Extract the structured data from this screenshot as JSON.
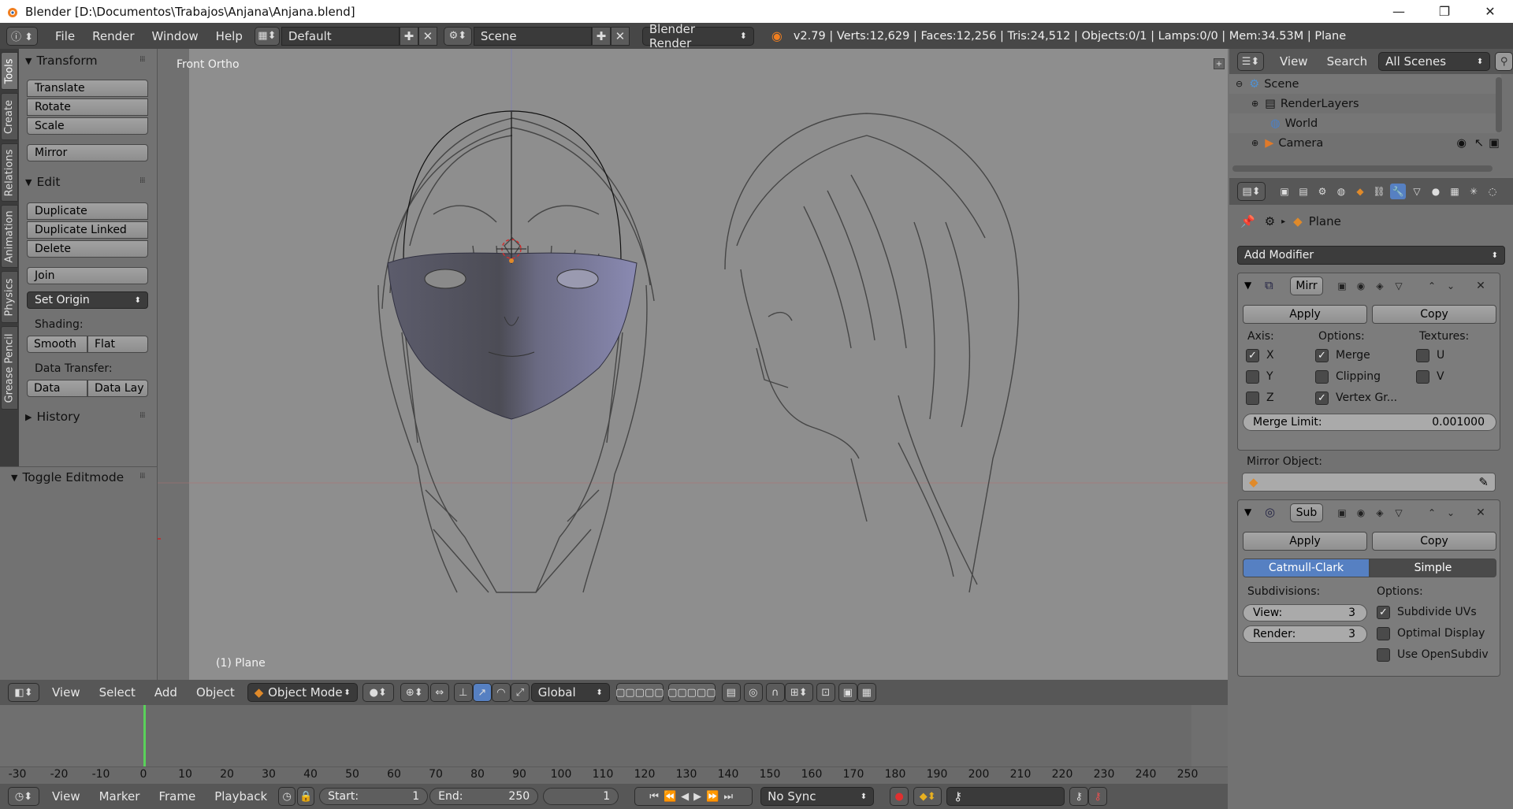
{
  "window": {
    "title": "Blender [D:\\Documentos\\Trabajos\\Anjana\\Anjana.blend]",
    "controls": [
      "—",
      "❐",
      "✕"
    ]
  },
  "infobar": {
    "menus": [
      "File",
      "Render",
      "Window",
      "Help"
    ],
    "screen_layout": "Default",
    "scene": "Scene",
    "render_engine": "Blender Render",
    "stats": "v2.79 | Verts:12,629 | Faces:12,256 | Tris:24,512 | Objects:0/1 | Lamps:0/0 | Mem:34.53M | Plane"
  },
  "left_tabs": [
    "Tools",
    "Create",
    "Relations",
    "Animation",
    "Physics",
    "Grease Pencil"
  ],
  "toolshelf": {
    "transform": {
      "title": "Transform",
      "buttons": [
        "Translate",
        "Rotate",
        "Scale",
        "Mirror"
      ]
    },
    "edit": {
      "title": "Edit",
      "buttons": [
        "Duplicate",
        "Duplicate Linked",
        "Delete",
        "Join"
      ],
      "set_origin": "Set Origin",
      "shading_label": "Shading:",
      "shading": [
        "Smooth",
        "Flat"
      ],
      "data_transfer_label": "Data Transfer:",
      "data_transfer": [
        "Data",
        "Data Lay"
      ]
    },
    "history": "History",
    "toggle_editmode": "Toggle Editmode"
  },
  "viewport": {
    "view_label": "Front Ortho",
    "object_label": "(1) Plane",
    "header_menus": [
      "View",
      "Select",
      "Add",
      "Object"
    ],
    "mode": "Object Mode",
    "orientation": "Global"
  },
  "timeline": {
    "ticks": [
      "-30",
      "-20",
      "-10",
      "0",
      "10",
      "20",
      "30",
      "40",
      "50",
      "60",
      "70",
      "80",
      "90",
      "100",
      "110",
      "120",
      "130",
      "140",
      "150",
      "160",
      "170",
      "180",
      "190",
      "200",
      "210",
      "220",
      "230",
      "240",
      "250"
    ],
    "menus": [
      "View",
      "Marker",
      "Frame",
      "Playback"
    ],
    "start_label": "Start:",
    "start": "1",
    "end_label": "End:",
    "end": "250",
    "current": "1",
    "sync": "No Sync"
  },
  "outliner": {
    "menus": [
      "View",
      "Search"
    ],
    "filter": "All Scenes",
    "items": [
      "Scene",
      "RenderLayers",
      "World",
      "Camera"
    ]
  },
  "properties": {
    "object_name": "Plane",
    "add_modifier": "Add Modifier",
    "mirror": {
      "name": "Mirr",
      "apply": "Apply",
      "copy": "Copy",
      "axis_label": "Axis:",
      "axes": [
        "X",
        "Y",
        "Z"
      ],
      "options_label": "Options:",
      "options": [
        "Merge",
        "Clipping",
        "Vertex Gr..."
      ],
      "textures_label": "Textures:",
      "textures": [
        "U",
        "V"
      ],
      "merge_limit_label": "Merge Limit:",
      "merge_limit": "0.001000",
      "mirror_object_label": "Mirror Object:"
    },
    "subsurf": {
      "name": "Sub",
      "apply": "Apply",
      "copy": "Copy",
      "types": [
        "Catmull-Clark",
        "Simple"
      ],
      "subdivisions_label": "Subdivisions:",
      "view_label": "View:",
      "view": "3",
      "render_label": "Render:",
      "render": "3",
      "options_label": "Options:",
      "options": [
        "Subdivide UVs",
        "Optimal Display",
        "Use OpenSubdiv"
      ]
    }
  },
  "colors": {
    "accent": "#5680c2",
    "header": "#474747",
    "viewport": "#8e8e8e"
  }
}
